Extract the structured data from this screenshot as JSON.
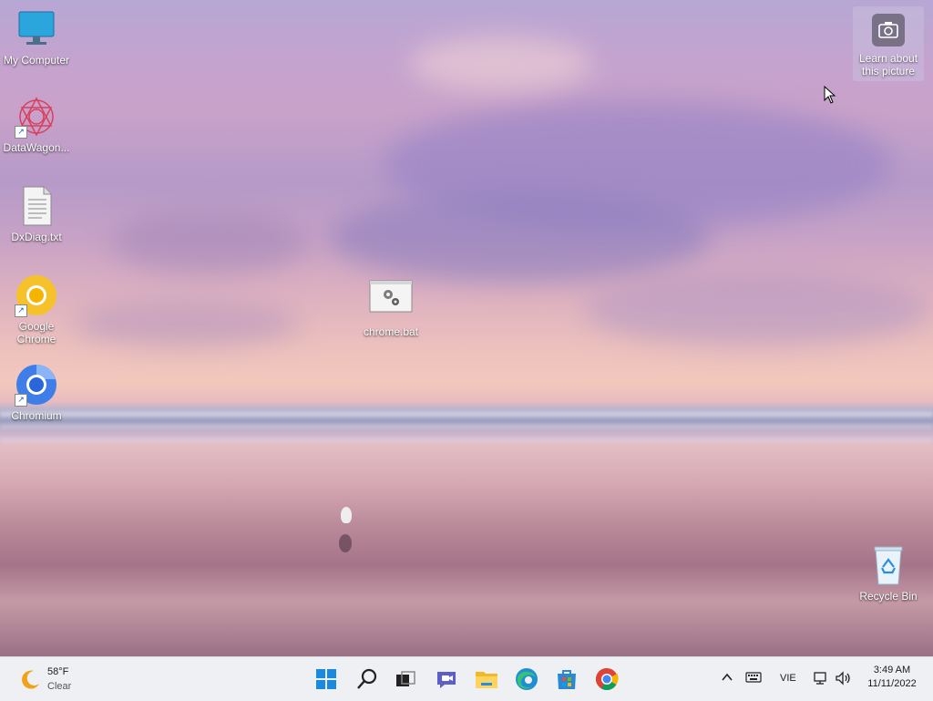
{
  "desktop": {
    "icons": [
      {
        "label": "My Computer",
        "icon": "monitor-icon"
      },
      {
        "label": "DataWagon...",
        "icon": "datawagon-icon"
      },
      {
        "label": "DxDiag.txt",
        "icon": "text-file-icon"
      },
      {
        "label": "Google Chrome",
        "icon": "chrome-icon"
      },
      {
        "label": "Chromium",
        "icon": "chromium-icon"
      },
      {
        "label": "chrome.bat",
        "icon": "batch-file-icon"
      },
      {
        "label": "Recycle Bin",
        "icon": "recycle-bin-icon"
      }
    ],
    "learn_widget": {
      "line1": "Learn about",
      "line2": "this picture",
      "icon": "camera-icon"
    }
  },
  "taskbar": {
    "weather": {
      "temp": "58°F",
      "condition": "Clear",
      "icon": "moon-icon"
    },
    "apps": [
      "start-icon",
      "search-icon",
      "task-view-icon",
      "chat-icon",
      "file-explorer-icon",
      "edge-icon",
      "store-icon",
      "chrome-icon"
    ],
    "tray": {
      "language": "VIE",
      "time": "3:49 AM",
      "date": "11/11/2022"
    }
  }
}
